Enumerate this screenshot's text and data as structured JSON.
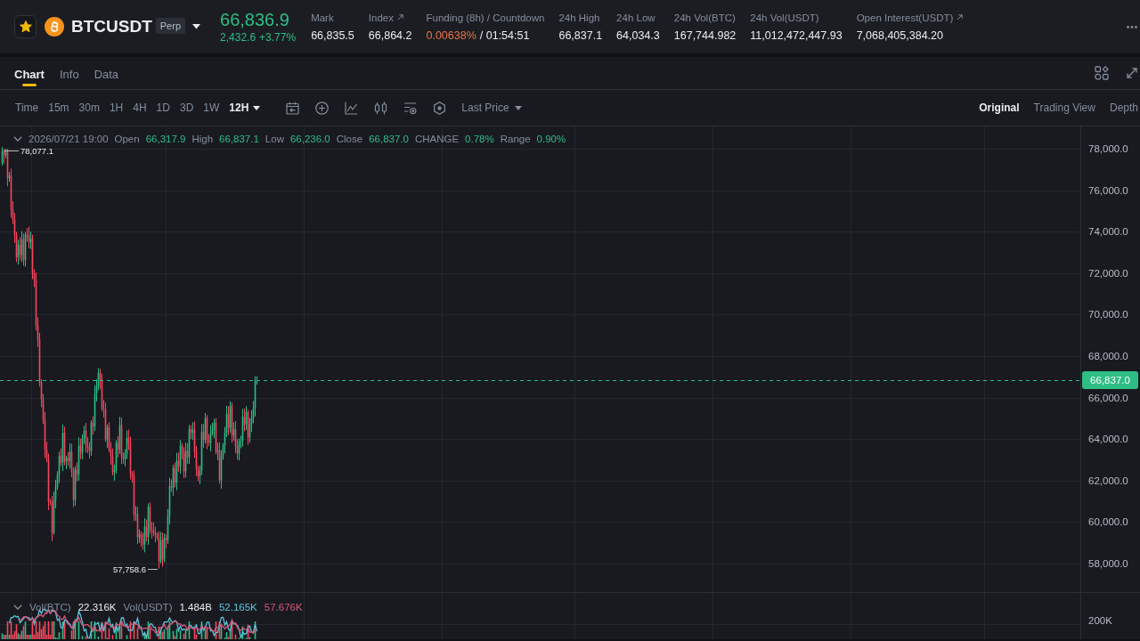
{
  "header": {
    "symbol": {
      "favorite": true,
      "name": "BTCUSDT",
      "badge": "Perp"
    },
    "price": {
      "last": "66,836.9",
      "change": "2,432.6",
      "change_percent": "+3.77%",
      "rising": true
    },
    "stats": [
      {
        "kind": "plain",
        "label": "Mark",
        "value": "66,835.5",
        "link": false
      },
      {
        "kind": "plain",
        "label": "Index",
        "value": "66,864.2",
        "link": true
      },
      {
        "kind": "funding",
        "label": "Funding (8h) / Countdown",
        "rate": "0.00638%",
        "countdown": "/ 01:54:51",
        "link": false
      },
      {
        "kind": "plain",
        "label": "24h High",
        "value": "66,837.1",
        "link": false
      },
      {
        "kind": "plain",
        "label": "24h Low",
        "value": "64,034.3",
        "link": false
      },
      {
        "kind": "plain",
        "label": "24h Vol(BTC)",
        "value": "167,744.982",
        "link": false
      },
      {
        "kind": "plain",
        "label": "24h Vol(USDT)",
        "value": "11,012,472,447.93",
        "link": false
      },
      {
        "kind": "plain",
        "label": "Open Interest(USDT)",
        "value": "7,068,405,384.20",
        "link": true
      }
    ]
  },
  "tabs": [
    {
      "label": "Chart",
      "selected": true
    },
    {
      "label": "Info",
      "selected": false
    },
    {
      "label": "Data",
      "selected": false
    }
  ],
  "toolbar": {
    "intervals": [
      {
        "kind": "button",
        "label": "Time",
        "selected": false
      },
      {
        "kind": "button",
        "label": "15m",
        "selected": false
      },
      {
        "kind": "button",
        "label": "30m",
        "selected": false
      },
      {
        "kind": "button",
        "label": "1H",
        "selected": false
      },
      {
        "kind": "button",
        "label": "4H",
        "selected": false
      },
      {
        "kind": "button",
        "label": "1D",
        "selected": false
      },
      {
        "kind": "button",
        "label": "3D",
        "selected": false
      },
      {
        "kind": "button",
        "label": "1W",
        "selected": false
      },
      {
        "kind": "menu",
        "label": "12H",
        "selected": true
      }
    ],
    "price_source": "Last Price",
    "views": [
      {
        "label": "Original",
        "selected": true
      },
      {
        "label": "Trading View",
        "selected": false
      },
      {
        "label": "Depth",
        "selected": false
      }
    ]
  },
  "chart": {
    "legend": {
      "time": "2026/07/21 19:00",
      "rising": true,
      "fields": [
        {
          "label": "Open",
          "value": "66,317.9"
        },
        {
          "label": "High",
          "value": "66,837.1"
        },
        {
          "label": "Low",
          "value": "66,236.0"
        },
        {
          "label": "Close",
          "value": "66,837.0"
        },
        {
          "label": "CHANGE",
          "value": "0.78%"
        },
        {
          "label": "Range",
          "value": "0.90%"
        }
      ]
    },
    "price_axis": [
      "78,000.0",
      "76,000.0",
      "74,000.0",
      "72,000.0",
      "70,000.0",
      "68,000.0",
      "66,000.0",
      "64,000.0",
      "62,000.0",
      "60,000.0",
      "58,000.0"
    ],
    "high_marker": "78,077.1",
    "low_marker": "57,758.6",
    "last_price": "66,837.0"
  },
  "volume": {
    "legend": [
      {
        "label": "Vol(BTC)",
        "value": "22.316K",
        "color": "#eaecef"
      },
      {
        "label": "Vol(USDT)",
        "value": "1.484B",
        "color": "#eaecef"
      },
      {
        "value": "52.165K",
        "color": "#5fc4dc"
      },
      {
        "value": "57.676K",
        "color": "#d9577a"
      }
    ],
    "axis_label": "200K"
  }
}
